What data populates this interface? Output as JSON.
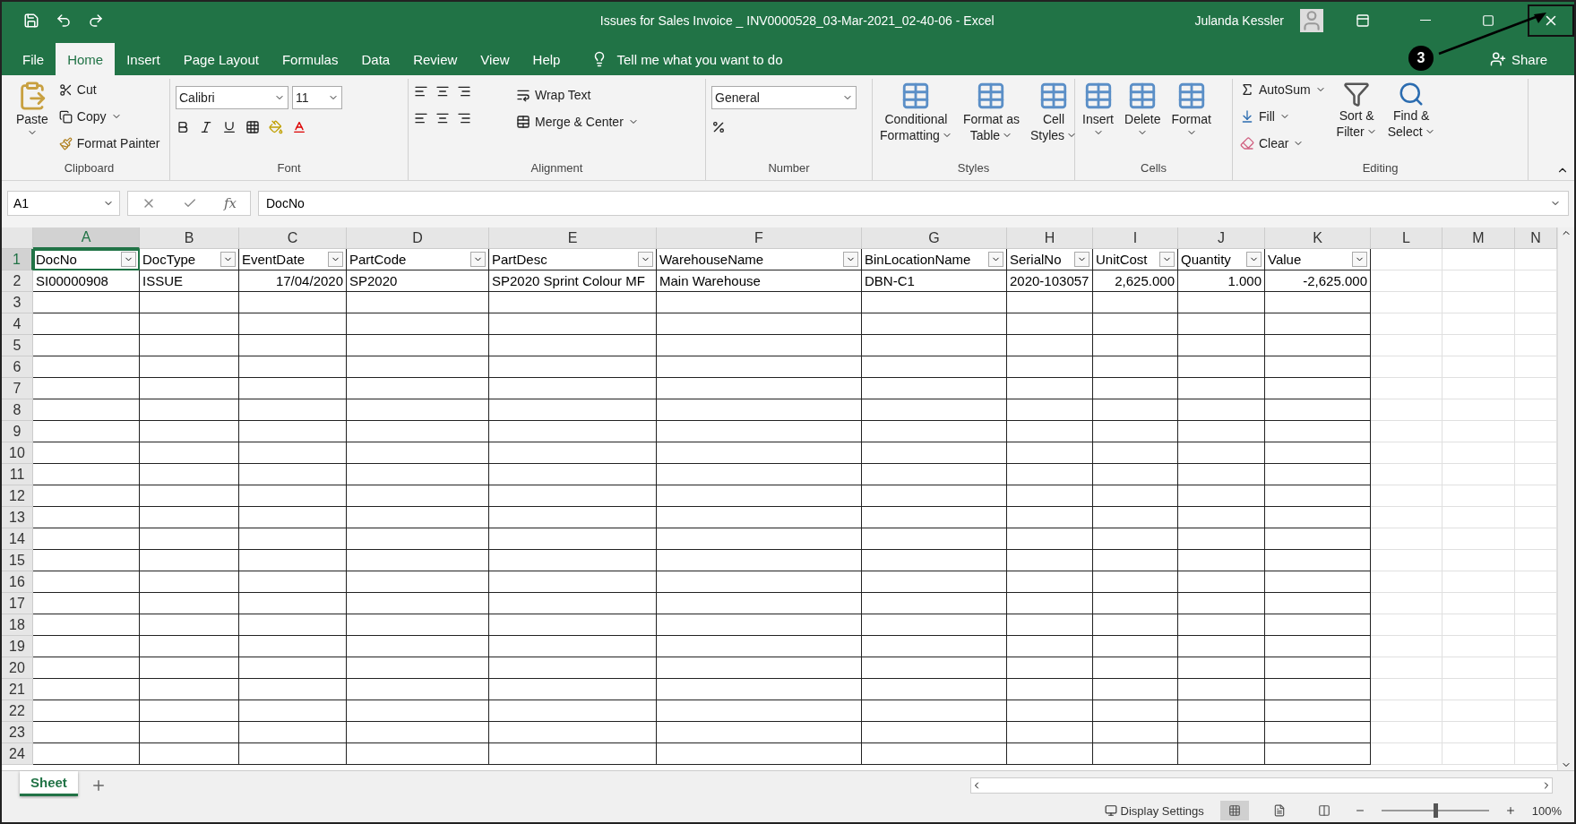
{
  "window": {
    "title": "Issues for Sales Invoice _ INV0000528_03-Mar-2021_02-40-06  -  Excel",
    "user": "Julanda Kessler"
  },
  "callout": {
    "number": "3"
  },
  "tabs": [
    {
      "label": "File",
      "selected": false
    },
    {
      "label": "Home",
      "selected": true
    },
    {
      "label": "Insert",
      "selected": false
    },
    {
      "label": "Page Layout",
      "selected": false
    },
    {
      "label": "Formulas",
      "selected": false
    },
    {
      "label": "Data",
      "selected": false
    },
    {
      "label": "Review",
      "selected": false
    },
    {
      "label": "View",
      "selected": false
    },
    {
      "label": "Help",
      "selected": false
    }
  ],
  "tell_me": "Tell me what you want to do",
  "share": "Share",
  "ribbon": {
    "clipboard": {
      "label": "Clipboard",
      "paste": "Paste",
      "cut": "Cut",
      "copy": "Copy",
      "format_painter": "Format Painter"
    },
    "font": {
      "label": "Font",
      "name": "Calibri",
      "size": "11"
    },
    "alignment": {
      "label": "Alignment",
      "wrap": "Wrap Text",
      "merge": "Merge & Center"
    },
    "number": {
      "label": "Number",
      "format": "General"
    },
    "styles": {
      "label": "Styles",
      "items": [
        {
          "line1": "Conditional",
          "line2": "Formatting"
        },
        {
          "line1": "Format as",
          "line2": "Table"
        },
        {
          "line1": "Cell",
          "line2": "Styles"
        }
      ]
    },
    "cells": {
      "label": "Cells",
      "items": [
        "Insert",
        "Delete",
        "Format"
      ]
    },
    "editing": {
      "label": "Editing",
      "autosum": "AutoSum",
      "fill": "Fill",
      "clear": "Clear",
      "sort": {
        "line1": "Sort &",
        "line2": "Filter"
      },
      "find": {
        "line1": "Find &",
        "line2": "Select"
      }
    }
  },
  "name_box": "A1",
  "fx_label": "fx",
  "formula": "DocNo",
  "columns": [
    {
      "letter": "A",
      "selected": true
    },
    {
      "letter": "B",
      "selected": false
    },
    {
      "letter": "C",
      "selected": false
    },
    {
      "letter": "D",
      "selected": false
    },
    {
      "letter": "E",
      "selected": false
    },
    {
      "letter": "F",
      "selected": false
    },
    {
      "letter": "G",
      "selected": false
    },
    {
      "letter": "H",
      "selected": false
    },
    {
      "letter": "I",
      "selected": false
    },
    {
      "letter": "J",
      "selected": false
    },
    {
      "letter": "K",
      "selected": false
    },
    {
      "letter": "L",
      "selected": false
    },
    {
      "letter": "M",
      "selected": false
    },
    {
      "letter": "N",
      "selected": false
    }
  ],
  "headers": [
    "DocNo",
    "DocType",
    "EventDate",
    "PartCode",
    "PartDesc",
    "WarehouseName",
    "BinLocationName",
    "SerialNo",
    "UnitCost",
    "Quantity",
    "Value"
  ],
  "rows": [
    {
      "number": "1",
      "selected": true
    },
    {
      "number": "2",
      "selected": false
    },
    {
      "number": "3",
      "selected": false
    },
    {
      "number": "4",
      "selected": false
    },
    {
      "number": "5",
      "selected": false
    },
    {
      "number": "6",
      "selected": false
    },
    {
      "number": "7",
      "selected": false
    },
    {
      "number": "8",
      "selected": false
    },
    {
      "number": "9",
      "selected": false
    },
    {
      "number": "10",
      "selected": false
    },
    {
      "number": "11",
      "selected": false
    },
    {
      "number": "12",
      "selected": false
    },
    {
      "number": "13",
      "selected": false
    },
    {
      "number": "14",
      "selected": false
    },
    {
      "number": "15",
      "selected": false
    },
    {
      "number": "16",
      "selected": false
    },
    {
      "number": "17",
      "selected": false
    },
    {
      "number": "18",
      "selected": false
    },
    {
      "number": "19",
      "selected": false
    },
    {
      "number": "20",
      "selected": false
    },
    {
      "number": "21",
      "selected": false
    },
    {
      "number": "22",
      "selected": false
    },
    {
      "number": "23",
      "selected": false
    },
    {
      "number": "24",
      "selected": false
    }
  ],
  "data_row": [
    {
      "text": "SI00000908",
      "kind": "text"
    },
    {
      "text": "ISSUE",
      "kind": "text"
    },
    {
      "text": "17/04/2020",
      "kind": "number"
    },
    {
      "text": "SP2020",
      "kind": "text"
    },
    {
      "text": "SP2020 Sprint Colour MF",
      "kind": "text"
    },
    {
      "text": "Main Warehouse",
      "kind": "text"
    },
    {
      "text": "DBN-C1",
      "kind": "text"
    },
    {
      "text": "2020-103057",
      "kind": "text"
    },
    {
      "text": "2,625.000",
      "kind": "number"
    },
    {
      "text": "1.000",
      "kind": "number"
    },
    {
      "text": "-2,625.000",
      "kind": "number"
    }
  ],
  "sheets": [
    {
      "label": "Sheet",
      "selected": true
    }
  ],
  "status": {
    "display_settings": "Display Settings",
    "views": [
      {
        "kind": "normal",
        "selected": true
      },
      {
        "kind": "layout",
        "selected": false
      },
      {
        "kind": "break",
        "selected": false
      }
    ],
    "zoom": {
      "level": 0.5,
      "reading": "100%"
    }
  }
}
